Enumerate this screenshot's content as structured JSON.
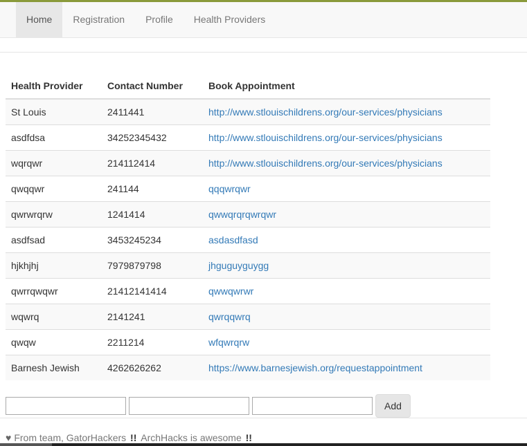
{
  "nav": {
    "items": [
      {
        "label": "Home",
        "active": true
      },
      {
        "label": "Registration"
      },
      {
        "label": "Profile"
      },
      {
        "label": "Health Providers"
      }
    ]
  },
  "table": {
    "headers": [
      "Health Provider",
      "Contact Number",
      "Book Appointment"
    ],
    "rows": [
      [
        "St Louis",
        "2411441",
        "http://www.stlouischildrens.org/our-services/physicians"
      ],
      [
        "asdfdsa",
        "34252345432",
        "http://www.stlouischildrens.org/our-services/physicians"
      ],
      [
        "wqrqwr",
        "214112414",
        "http://www.stlouischildrens.org/our-services/physicians"
      ],
      [
        "qwqqwr",
        "241144",
        "qqqwrqwr"
      ],
      [
        "qwrwrqrw",
        "1241414",
        "qwwqrqrqwrqwr"
      ],
      [
        "asdfsad",
        "3453245234",
        "asdasdfasd"
      ],
      [
        "hjkhjhj",
        "7979879798",
        "jhguguyguygg"
      ],
      [
        "qwrrqwqwr",
        "21412141414",
        "qwwqwrwr"
      ],
      [
        "wqwrq",
        "2141241",
        "qwrqqwrq"
      ],
      [
        "qwqw",
        "2211214",
        "wfqwrqrw"
      ],
      [
        "Barnesh Jewish",
        "4262626262",
        "https://www.barnesjewish.org/requestappointment"
      ]
    ]
  },
  "form": {
    "provider_value": "",
    "contact_value": "",
    "link_value": "",
    "add_label": "Add"
  },
  "footer": {
    "icon": "heart-icon",
    "text1": "From team,",
    "team": "GatorHackers",
    "bang1": "!!",
    "text2": "ArchHacks is awesome",
    "bang2": "!!"
  }
}
